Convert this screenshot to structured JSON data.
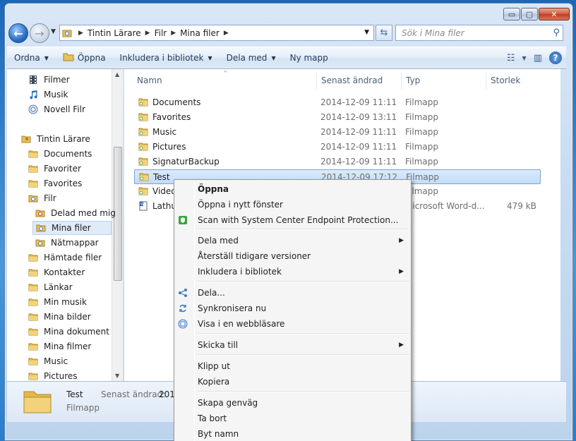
{
  "window": {
    "controls": {
      "minimize": "▭",
      "maximize": "▢",
      "close": "✕"
    }
  },
  "address": {
    "crumbs": [
      "Tintin Lärare",
      "Filr",
      "Mina filer"
    ],
    "search_placeholder": "Sök i Mina filer"
  },
  "toolbar": {
    "items": [
      "Ordna",
      "Öppna",
      "Inkludera i bibliotek",
      "Dela med",
      "Ny mapp"
    ]
  },
  "navpane": {
    "items": [
      {
        "label": "Filmer",
        "icon": "film-icon"
      },
      {
        "label": "Musik",
        "icon": "music-icon"
      },
      {
        "label": "Novell Filr",
        "icon": "filr-icon"
      },
      {
        "label": "Tintin Lärare",
        "icon": "user-folder-icon"
      },
      {
        "label": "Documents",
        "icon": "folder-icon"
      },
      {
        "label": "Favoriter",
        "icon": "folder-icon"
      },
      {
        "label": "Favorites",
        "icon": "folder-icon"
      },
      {
        "label": "Filr",
        "icon": "filr-folder-icon"
      },
      {
        "label": "Delad med mig",
        "icon": "shared-folder-icon"
      },
      {
        "label": "Mina filer",
        "icon": "filr-folder-icon"
      },
      {
        "label": "Nätmappar",
        "icon": "filr-folder-icon"
      },
      {
        "label": "Hämtade filer",
        "icon": "folder-icon"
      },
      {
        "label": "Kontakter",
        "icon": "folder-icon"
      },
      {
        "label": "Länkar",
        "icon": "folder-icon"
      },
      {
        "label": "Min musik",
        "icon": "folder-icon"
      },
      {
        "label": "Mina bilder",
        "icon": "folder-icon"
      },
      {
        "label": "Mina dokument",
        "icon": "folder-icon"
      },
      {
        "label": "Mina filmer",
        "icon": "folder-icon"
      },
      {
        "label": "Music",
        "icon": "folder-icon"
      },
      {
        "label": "Pictures",
        "icon": "folder-icon"
      }
    ]
  },
  "columns": {
    "name": "Namn",
    "date": "Senast ändrad",
    "type": "Typ",
    "size": "Storlek"
  },
  "files": [
    {
      "name": "Documents",
      "date": "2014-12-09 11:11",
      "type": "Filmapp",
      "size": ""
    },
    {
      "name": "Favorites",
      "date": "2014-12-09 13:11",
      "type": "Filmapp",
      "size": ""
    },
    {
      "name": "Music",
      "date": "2014-12-09 11:11",
      "type": "Filmapp",
      "size": ""
    },
    {
      "name": "Pictures",
      "date": "2014-12-09 11:11",
      "type": "Filmapp",
      "size": ""
    },
    {
      "name": "SignaturBackup",
      "date": "2014-12-09 11:11",
      "type": "Filmapp",
      "size": ""
    },
    {
      "name": "Test",
      "date": "2014-12-09 17:12",
      "type": "Filmapp",
      "size": ""
    },
    {
      "name": "Video",
      "date": "",
      "type": "Filmapp",
      "size": ""
    },
    {
      "name": "Lathu",
      "date": "",
      "type": "Microsoft Word-d...",
      "size": "479 kB"
    }
  ],
  "details": {
    "name": "Test",
    "type": "Filmapp",
    "date_label": "Senast ändrad:",
    "date": "2014"
  },
  "context_menu": {
    "items": [
      {
        "label": "Öppna"
      },
      {
        "label": "Öppna i nytt fönster"
      },
      {
        "label": "Scan with System Center Endpoint Protection..."
      },
      {
        "label": "Dela med"
      },
      {
        "label": "Återställ tidigare versioner"
      },
      {
        "label": "Inkludera i bibliotek"
      },
      {
        "label": "Dela..."
      },
      {
        "label": "Synkronisera nu"
      },
      {
        "label": "Visa i en webbläsare"
      },
      {
        "label": "Skicka till"
      },
      {
        "label": "Klipp ut"
      },
      {
        "label": "Kopiera"
      },
      {
        "label": "Skapa genväg"
      },
      {
        "label": "Ta bort"
      },
      {
        "label": "Byt namn"
      }
    ]
  },
  "colors": {
    "selection": "#c2dcfa",
    "accent": "#1f5ba8",
    "folder": "#e8c25a"
  }
}
